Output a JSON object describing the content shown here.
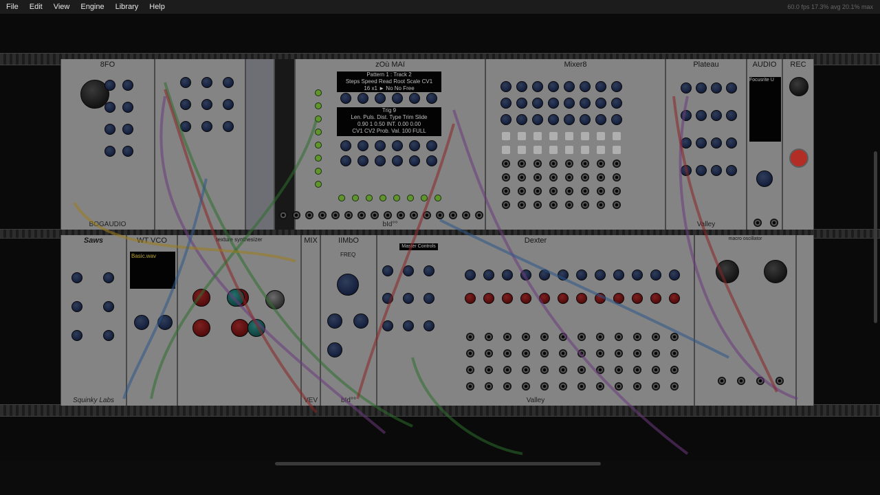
{
  "menu": {
    "items": [
      {
        "label": "File"
      },
      {
        "label": "Edit"
      },
      {
        "label": "View"
      },
      {
        "label": "Engine"
      },
      {
        "label": "Library"
      },
      {
        "label": "Help"
      }
    ],
    "stats": "60.0 fps  17.3% avg  20.1% max"
  },
  "modules": {
    "bfo": {
      "title": "8FO",
      "footer": "BOGAUDIO"
    },
    "zou": {
      "title": "zOù MAï",
      "footer": "bId°°",
      "lcd1_line1": "Pattern 1 : Track 2",
      "lcd1_line2": "Steps  Speed  Read  Root  Scale  CV1",
      "lcd1_line3": "16      x1      ►      No     No    Free",
      "lcd2_line1": "Trig 9",
      "lcd2_line2": "Len.  Puls.  Dist.  Type  Trim  Slide",
      "lcd2_line3": "0.90   1      0.50   INT.  0.00  0.00",
      "lcd2_line4": "CV1   CV2   Prob.  Val.  100   FULL"
    },
    "mixer": {
      "title": "Mixer8"
    },
    "plateau": {
      "title": "Plateau",
      "footer": "Valley"
    },
    "audio": {
      "title": "AUDIO",
      "device": "Focusrite U"
    },
    "rec": {
      "title": "REC"
    },
    "saws": {
      "title": "Saws",
      "footer": "Squinky Labs"
    },
    "wtvco": {
      "title": "WT VCO",
      "screen": "Basic.wav"
    },
    "texture": {
      "title": "texture synthesizer"
    },
    "mix": {
      "title": "MIX",
      "footer": "VEV"
    },
    "imbo": {
      "title": "IIMbO",
      "freq_label": "FREQ",
      "footer": "bId°°"
    },
    "dexter": {
      "title": "Dexter",
      "master": "Master Controls",
      "footer": "Valley"
    },
    "macro": {
      "title": "macro oscillator"
    }
  },
  "colors": {
    "panel": "#a9a9a9",
    "rec_button": "#e63a32",
    "led_green": "#7bbf3a"
  }
}
